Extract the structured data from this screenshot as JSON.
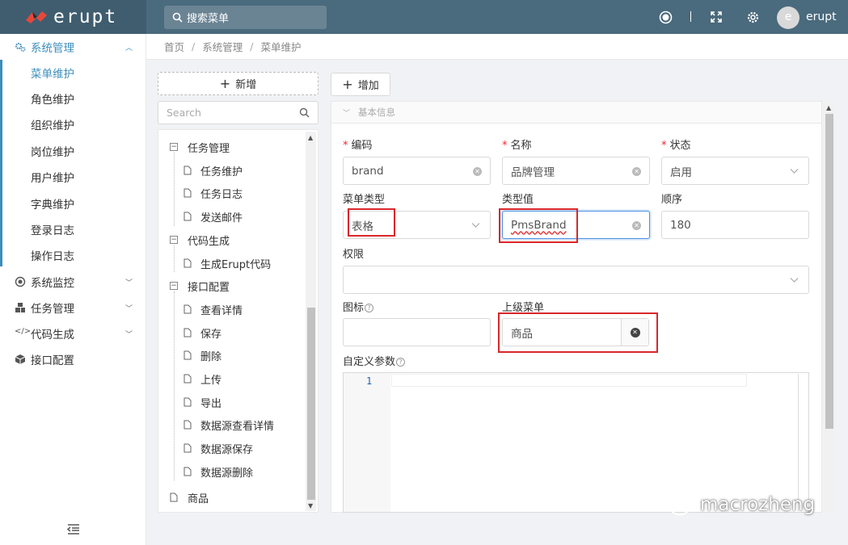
{
  "header": {
    "logo_text": "erupt",
    "search_placeholder": "搜索菜单",
    "user_initial": "e",
    "user_name": "erupt",
    "icons": [
      "record-icon",
      "fullscreen-icon",
      "gear-icon"
    ],
    "bg_color": "#4a6a7d"
  },
  "sidebar": {
    "groups": [
      {
        "label": "系统管理",
        "icon": "gears-icon",
        "expanded": true,
        "items": [
          "菜单维护",
          "角色维护",
          "组织维护",
          "岗位维护",
          "用户维护",
          "字典维护",
          "登录日志",
          "操作日志"
        ]
      },
      {
        "label": "系统监控",
        "icon": "target-icon"
      },
      {
        "label": "任务管理",
        "icon": "cubes-icon"
      },
      {
        "label": "代码生成",
        "icon": "code-icon"
      },
      {
        "label": "接口配置",
        "icon": "cube-icon"
      }
    ],
    "active_color": "#3c8dbc"
  },
  "breadcrumb": [
    "首页",
    "系统管理",
    "菜单维护"
  ],
  "tree": {
    "add_label": "新增",
    "search_placeholder": "Search",
    "nodes": [
      {
        "label": "任务管理",
        "children": [
          "任务维护",
          "任务日志",
          "发送邮件"
        ]
      },
      {
        "label": "代码生成",
        "children": [
          "生成Erupt代码"
        ]
      },
      {
        "label": "接口配置",
        "children": [
          "查看详情",
          "保存",
          "删除",
          "上传",
          "导出",
          "数据源查看详情",
          "数据源保存",
          "数据源删除"
        ]
      },
      {
        "label": "商品",
        "children": []
      }
    ]
  },
  "form": {
    "add_label": "增加",
    "section_title": "基本信息",
    "fields": {
      "code": {
        "label": "编码",
        "value": "brand",
        "required": true
      },
      "name": {
        "label": "名称",
        "value": "品牌管理",
        "required": true
      },
      "status": {
        "label": "状态",
        "value": "启用",
        "required": true
      },
      "menu_type": {
        "label": "菜单类型",
        "value": "表格"
      },
      "type_value": {
        "label": "类型值",
        "value": "PmsBrand"
      },
      "order": {
        "label": "顺序",
        "value": "180"
      },
      "permission": {
        "label": "权限",
        "value": ""
      },
      "icon": {
        "label": "图标",
        "value": ""
      },
      "parent_menu": {
        "label": "上级菜单",
        "value": "商品"
      },
      "custom_params": {
        "label": "自定义参数",
        "line_number": "1"
      }
    },
    "highlight_color": "#d9262b"
  },
  "watermark": "macrozheng"
}
